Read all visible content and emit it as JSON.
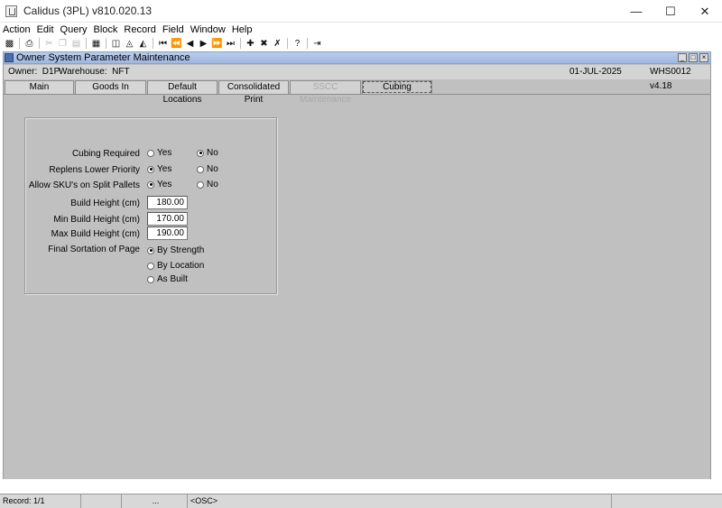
{
  "window": {
    "title": "Calidus (3PL) v810.020.13",
    "minimize": "—",
    "maximize": "☐",
    "close": "✕"
  },
  "menu": [
    "Action",
    "Edit",
    "Query",
    "Block",
    "Record",
    "Field",
    "Window",
    "Help"
  ],
  "toolbar": {
    "icons": [
      "save-icon",
      "print-icon",
      "cut-icon",
      "copy-icon",
      "paste-icon",
      "clear-icon",
      "enter-query-icon",
      "execute-query-icon",
      "cancel-query-icon",
      "first-record-icon",
      "previous-block-icon",
      "previous-record-icon",
      "next-record-icon",
      "next-block-icon",
      "last-record-icon",
      "insert-record-icon",
      "delete-record-icon",
      "clear-record-icon",
      "help-icon",
      "exit-icon"
    ]
  },
  "form": {
    "title": "Owner System Parameter Maintenance",
    "owner_label": "Owner:",
    "owner_value": "D1P",
    "warehouse_label": "Warehouse:",
    "warehouse_value": "NFT",
    "date": "01-JUL-2025",
    "screen_code": "WHS0012",
    "version": "v4.18"
  },
  "tabs": [
    {
      "label": "Main",
      "state": "normal"
    },
    {
      "label": "Goods In",
      "state": "normal"
    },
    {
      "label": "Default Locations",
      "state": "normal"
    },
    {
      "label": "Consolidated Print",
      "state": "normal"
    },
    {
      "label": "SSCC Maintenance",
      "state": "disabled"
    },
    {
      "label": "Cubing",
      "state": "active"
    }
  ],
  "cubing": {
    "cubing_required": {
      "label": "Cubing Required",
      "yes": "Yes",
      "no": "No",
      "selected": "No"
    },
    "replens_lower_priority": {
      "label": "Replens Lower Priority",
      "yes": "Yes",
      "no": "No",
      "selected": "Yes"
    },
    "allow_skus_split": {
      "label": "Allow SKU's on Split Pallets",
      "yes": "Yes",
      "no": "No",
      "selected": "Yes"
    },
    "build_height": {
      "label": "Build Height (cm)",
      "value": "180.00"
    },
    "min_build_height": {
      "label": "Min Build Height (cm)",
      "value": "170.00"
    },
    "max_build_height": {
      "label": "Max Build Height (cm)",
      "value": "190.00"
    },
    "final_sortation": {
      "label": "Final Sortation of Page",
      "options": [
        "By Strength",
        "By Location",
        "As Built"
      ],
      "selected": "By Strength"
    }
  },
  "status": {
    "record": "Record: 1/1",
    "ellipsis": "...",
    "osc": "<OSC>"
  }
}
